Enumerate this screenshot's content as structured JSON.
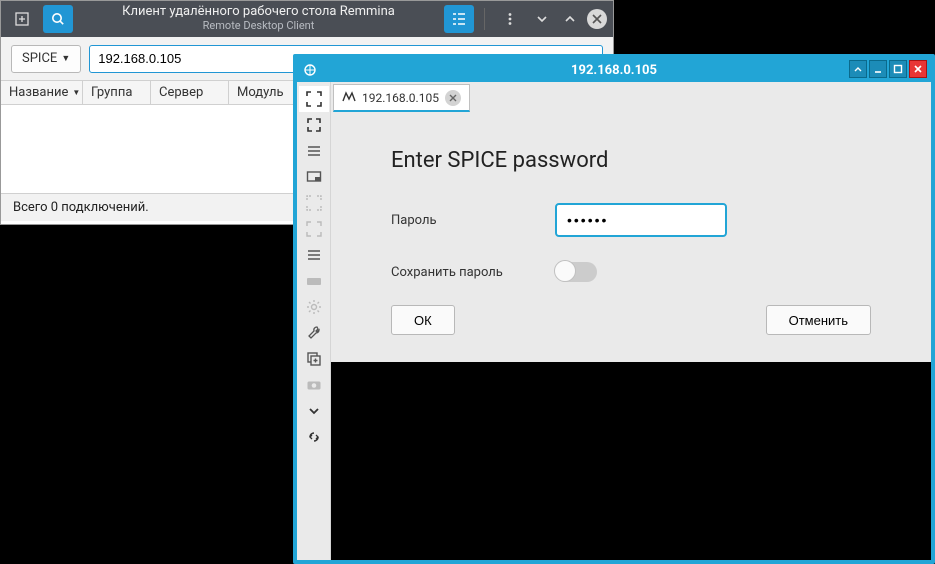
{
  "main_window": {
    "title": "Клиент удалённого рабочего стола Remmina",
    "subtitle": "Remote Desktop Client",
    "protocol_selector": "SPICE",
    "address_value": "192.168.0.105",
    "columns": {
      "name": "Название",
      "group": "Группа",
      "server": "Сервер",
      "module": "Модуль"
    },
    "status_text": "Всего 0 подключений."
  },
  "connection_window": {
    "title": "192.168.0.105",
    "tab": {
      "label": "192.168.0.105"
    },
    "dialog": {
      "heading": "Enter SPICE password",
      "password_label": "Пароль",
      "password_value": "••••••",
      "save_password_label": "Сохранить пароль",
      "save_password_on": false,
      "ok_label": "ОК",
      "cancel_label": "Отменить"
    }
  },
  "colors": {
    "accent": "#22a5d6",
    "toolbar_active": "#2196d4"
  }
}
